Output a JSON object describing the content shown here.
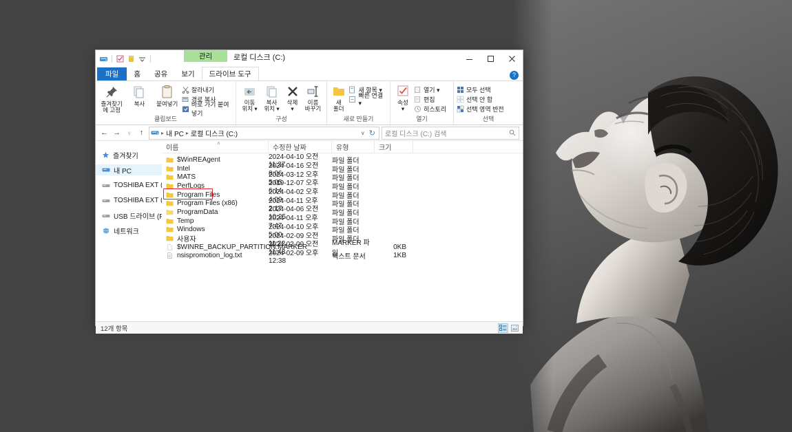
{
  "desktop": {
    "background_color": "#444444"
  },
  "photo": {
    "description": "black-and-white portrait of a person with head tilted back",
    "bg_top_color": "#6e6e6e",
    "bg_bottom_color": "#3b3b3b"
  },
  "window": {
    "title": "로컬 디스크 (C:)",
    "contextual_tab": "관리",
    "quick_access": [
      {
        "name": "drive-icon",
        "glyph": "▤"
      },
      {
        "name": "properties-icon",
        "glyph": "☑"
      },
      {
        "name": "new-folder-icon",
        "glyph": "▮"
      },
      {
        "name": "customize-qat-icon",
        "glyph": "▾"
      }
    ],
    "controls": {
      "minimize": "—",
      "maximize": "□",
      "close": "✕"
    },
    "help_label": "?"
  },
  "tabs": [
    {
      "label": "파일",
      "selected": false,
      "kind": "file"
    },
    {
      "label": "홈",
      "selected": false,
      "kind": "normal"
    },
    {
      "label": "공유",
      "selected": false,
      "kind": "normal"
    },
    {
      "label": "보기",
      "selected": false,
      "kind": "normal"
    },
    {
      "label": "드라이브 도구",
      "selected": true,
      "kind": "contextual"
    }
  ],
  "ribbon": {
    "groups": [
      {
        "label": "클립보드",
        "big_buttons": [
          {
            "label": "즐겨찾기에\n고정",
            "icon": "pin-icon"
          },
          {
            "label": "복사",
            "icon": "copy-icon"
          },
          {
            "label": "붙여넣기",
            "icon": "paste-icon"
          }
        ],
        "small_items": [
          {
            "label": "잘라내기",
            "icon": "scissors-icon"
          },
          {
            "label": "경로 복사",
            "icon": "copy-path-icon"
          },
          {
            "label": "바로 가기 붙여넣기",
            "icon": "paste-shortcut-icon"
          }
        ]
      },
      {
        "label": "구성",
        "big_buttons": [
          {
            "label": "이동\n위치 ▾",
            "icon": "move-to-icon"
          },
          {
            "label": "복사\n위치 ▾",
            "icon": "copy-to-icon"
          },
          {
            "label": "삭제\n▾",
            "icon": "delete-icon"
          },
          {
            "label": "이름\n바꾸기",
            "icon": "rename-icon"
          }
        ],
        "small_items": []
      },
      {
        "label": "새로 만들기",
        "big_buttons": [
          {
            "label": "새\n폴더",
            "icon": "new-folder-icon"
          }
        ],
        "small_items": [
          {
            "label": "새 항목 ▾",
            "icon": "new-item-icon"
          },
          {
            "label": "빠른 연결 ▾",
            "icon": "easy-access-icon"
          }
        ]
      },
      {
        "label": "열기",
        "big_buttons": [
          {
            "label": "속성\n▾",
            "icon": "properties-icon"
          }
        ],
        "small_items": [
          {
            "label": "열기 ▾",
            "icon": "open-icon"
          },
          {
            "label": "편집",
            "icon": "edit-icon"
          },
          {
            "label": "히스토리",
            "icon": "history-icon"
          }
        ]
      },
      {
        "label": "선택",
        "big_buttons": [],
        "small_items": [
          {
            "label": "모두 선택",
            "icon": "select-all-icon"
          },
          {
            "label": "선택 안 함",
            "icon": "select-none-icon"
          },
          {
            "label": "선택 영역 반전",
            "icon": "invert-selection-icon"
          }
        ]
      }
    ]
  },
  "addressbar": {
    "back": "←",
    "forward": "→",
    "recent": "∨",
    "up": "↑",
    "breadcrumbs": [
      "내 PC",
      "로컬 디스크 (C:)"
    ],
    "dropdown": "∨",
    "refresh": "↻",
    "search_placeholder": "로컬 디스크 (C:) 검색",
    "search_value": ""
  },
  "navpane": {
    "items": [
      {
        "label": "즐겨찾기",
        "icon": "star-icon",
        "selected": false
      },
      {
        "label": "내 PC",
        "icon": "pc-icon",
        "selected": true
      },
      {
        "label": "TOSHIBA EXT (G:)",
        "icon": "drive-icon",
        "selected": false
      },
      {
        "label": "TOSHIBA EXT (H:)",
        "icon": "drive-icon",
        "selected": false
      },
      {
        "label": "USB 드라이브 (F:)",
        "icon": "drive-icon",
        "selected": false
      },
      {
        "label": "네트워크",
        "icon": "network-icon",
        "selected": false
      }
    ]
  },
  "filelist": {
    "columns": [
      "이름",
      "수정한 날짜",
      "유형",
      "크기"
    ],
    "sort_indicator": "˄",
    "highlighted_row_name": "Program Files",
    "rows": [
      {
        "name": "$WinREAgent",
        "date": "2024-04-10 오전 11:37",
        "type": "파일 폴더",
        "size": "",
        "icon": "folder-icon"
      },
      {
        "name": "Intel",
        "date": "2024-04-16 오전 8:06",
        "type": "파일 폴더",
        "size": "",
        "icon": "folder-icon"
      },
      {
        "name": "MATS",
        "date": "2024-03-12 오후 5:05",
        "type": "파일 폴더",
        "size": "",
        "icon": "folder-icon"
      },
      {
        "name": "PerfLogs",
        "date": "2019-12-07 오후 6:14",
        "type": "파일 폴더",
        "size": "",
        "icon": "folder-icon"
      },
      {
        "name": "Program Files",
        "date": "2024-04-02 오후 4:09",
        "type": "파일 폴더",
        "size": "",
        "icon": "folder-icon"
      },
      {
        "name": "Program Files (x86)",
        "date": "2024-04-11 오후 2:17",
        "type": "파일 폴더",
        "size": "",
        "icon": "folder-icon"
      },
      {
        "name": "ProgramData",
        "date": "2024-04-06 오전 10:25",
        "type": "파일 폴더",
        "size": "",
        "icon": "folder-icon"
      },
      {
        "name": "Temp",
        "date": "2024-04-11 오후 7:47",
        "type": "파일 폴더",
        "size": "",
        "icon": "folder-icon"
      },
      {
        "name": "Windows",
        "date": "2024-04-10 오후 5:00",
        "type": "파일 폴더",
        "size": "",
        "icon": "folder-icon"
      },
      {
        "name": "사용자",
        "date": "2024-02-09 오전 11:22",
        "type": "파일 폴더",
        "size": "",
        "icon": "folder-icon"
      },
      {
        "name": "$WINRE_BACKUP_PARTITION.MARKER",
        "date": "2024-02-09 오전 11:43",
        "type": "MARKER 파일",
        "size": "0KB",
        "icon": "generic-file-icon"
      },
      {
        "name": "nsispromotion_log.txt",
        "date": "2024-02-09 오후 12:38",
        "type": "텍스트 문서",
        "size": "1KB",
        "icon": "text-file-icon"
      }
    ]
  },
  "statusbar": {
    "item_count": "12개 항목",
    "views": [
      {
        "name": "details-view-button",
        "active": true
      },
      {
        "name": "large-icons-view-button",
        "active": false
      }
    ]
  }
}
